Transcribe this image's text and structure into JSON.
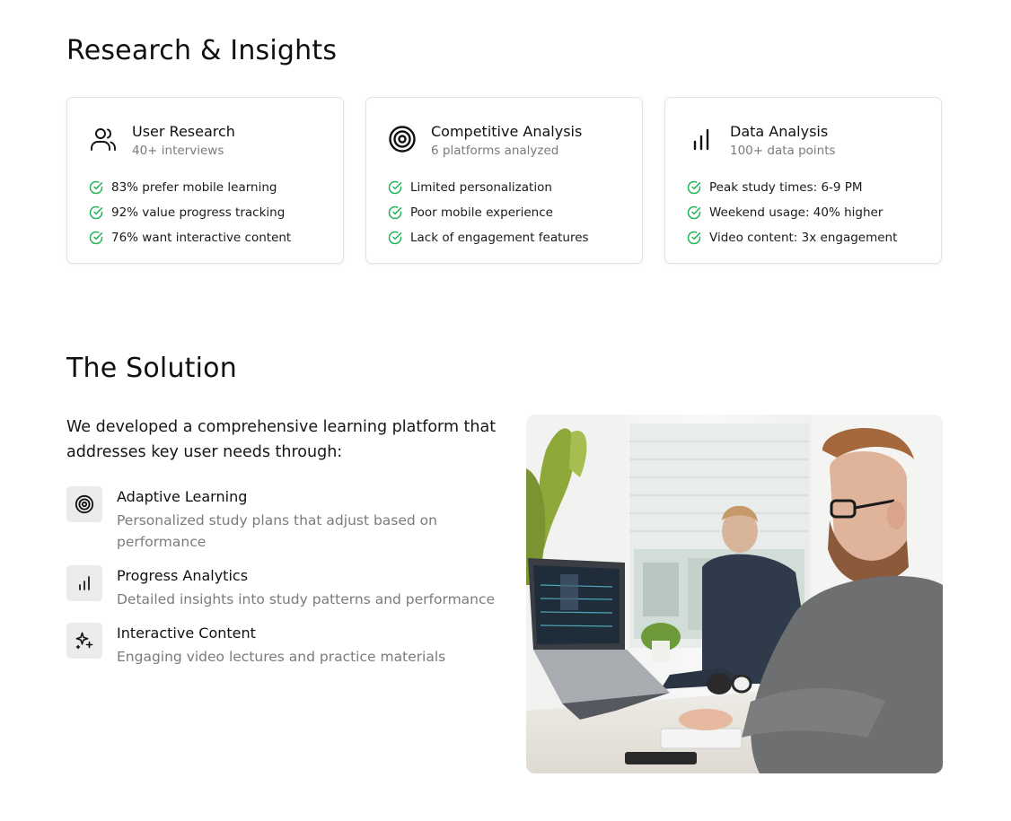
{
  "research": {
    "title": "Research & Insights",
    "cards": [
      {
        "icon": "users-icon",
        "title": "User Research",
        "subtitle": "40+ interviews",
        "items": [
          "83% prefer mobile learning",
          "92% value progress tracking",
          "76% want interactive content"
        ]
      },
      {
        "icon": "target-icon",
        "title": "Competitive Analysis",
        "subtitle": "6 platforms analyzed",
        "items": [
          "Limited personalization",
          "Poor mobile experience",
          "Lack of engagement features"
        ]
      },
      {
        "icon": "bar-chart-icon",
        "title": "Data Analysis",
        "subtitle": "100+ data points",
        "items": [
          "Peak study times: 6-9 PM",
          "Weekend usage: 40% higher",
          "Video content: 3x engagement"
        ]
      }
    ]
  },
  "solution": {
    "title": "The Solution",
    "intro": "We developed a comprehensive learning platform that addresses key user needs through:",
    "features": [
      {
        "icon": "target-icon",
        "title": "Adaptive Learning",
        "description": "Personalized study plans that adjust based on performance"
      },
      {
        "icon": "bar-chart-icon",
        "title": "Progress Analytics",
        "description": "Detailed insights into study patterns and performance"
      },
      {
        "icon": "sparkles-icon",
        "title": "Interactive Content",
        "description": "Engaging video lectures and practice materials"
      }
    ],
    "image": "photo of two men working at laptops in a bright office"
  },
  "colors": {
    "check": "#22b45a",
    "text": "#111111",
    "muted": "#7a7a7a",
    "border": "#e3e3e3",
    "icon_bg": "#ebebeb"
  }
}
